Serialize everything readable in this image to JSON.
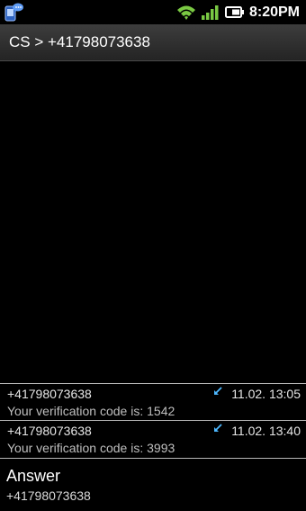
{
  "status_bar": {
    "time": "8:20PM",
    "icons": [
      "sms-notification-icon",
      "wifi-icon",
      "signal-icon",
      "battery-icon"
    ],
    "colors": {
      "wifi": "#7ac943",
      "signal": "#7ac943",
      "notification": "#3a78d8"
    }
  },
  "title_bar": {
    "title": "CS > +41798073638"
  },
  "messages": [
    {
      "from": "+41798073638",
      "date": "11.02. 13:05",
      "body": "Your verification code is: 1542",
      "direction_icon": "incoming-arrow-icon"
    },
    {
      "from": "+41798073638",
      "date": "11.02. 13:40",
      "body": "Your verification code is: 3993",
      "direction_icon": "incoming-arrow-icon"
    }
  ],
  "answer": {
    "label": "Answer",
    "number": "+41798073638"
  },
  "colors": {
    "background": "#000000",
    "arrow": "#4db8ff",
    "divider": "#b8b8b8"
  }
}
